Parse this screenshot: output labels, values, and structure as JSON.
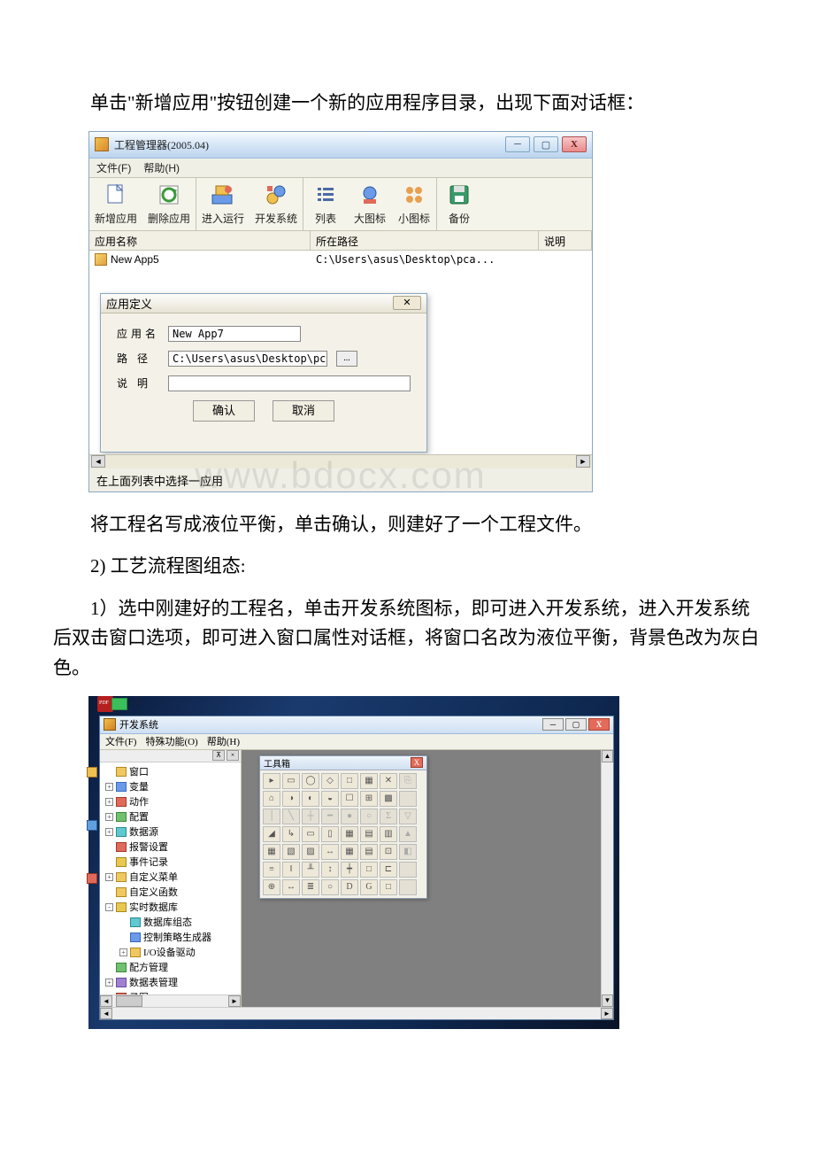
{
  "paragraphs": {
    "p1": "单击\"新增应用\"按钮创建一个新的应用程序目录，出现下面对话框：",
    "p2": "将工程名写成液位平衡，单击确认，则建好了一个工程文件。",
    "p3": "2) 工艺流程图组态:",
    "p4": "1）选中刚建好的工程名，单击开发系统图标，即可进入开发系统，进入开发系统后双击窗口选项，即可进入窗口属性对话框，将窗口名改为液位平衡，背景色改为灰白色。"
  },
  "watermark": "www.bdocx.com",
  "pm": {
    "title": "工程管理器(2005.04)",
    "menu_file": "文件(F)",
    "menu_help": "帮助(H)",
    "tb": {
      "new": "新增应用",
      "del": "删除应用",
      "run": "进入运行",
      "dev": "开发系统",
      "list": "列表",
      "big": "大图标",
      "small": "小图标",
      "backup": "备份"
    },
    "col_name": "应用名称",
    "col_path": "所在路径",
    "col_desc": "说明",
    "row_name": "New App5",
    "row_path": "C:\\Users\\asus\\Desktop\\pca...",
    "status": "在上面列表中选择一应用",
    "dlg": {
      "title": "应用定义",
      "close": "✕",
      "lbl_name": "应用名",
      "lbl_path": "路  径",
      "lbl_desc": "说  明",
      "val_name": "New App7",
      "val_path": "C:\\Users\\asus\\Desktop\\pc",
      "browse": "...",
      "ok": "确认",
      "cancel": "取消"
    }
  },
  "ds": {
    "title": "开发系统",
    "menu_file": "文件(F)",
    "menu_special": "特殊功能(O)",
    "menu_help": "帮助(H)",
    "tree": [
      {
        "level": 0,
        "exp": "",
        "icon": "folder",
        "label": "窗口"
      },
      {
        "level": 0,
        "exp": "+",
        "icon": "blue",
        "label": "变量"
      },
      {
        "level": 0,
        "exp": "+",
        "icon": "red",
        "label": "动作"
      },
      {
        "level": 0,
        "exp": "+",
        "icon": "green",
        "label": "配置"
      },
      {
        "level": 0,
        "exp": "+",
        "icon": "cyan",
        "label": "数据源"
      },
      {
        "level": 0,
        "exp": "",
        "icon": "red",
        "label": "报警设置"
      },
      {
        "level": 0,
        "exp": "",
        "icon": "yellow",
        "label": "事件记录"
      },
      {
        "level": 0,
        "exp": "+",
        "icon": "folder",
        "label": "自定义菜单"
      },
      {
        "level": 0,
        "exp": "",
        "icon": "folder",
        "label": "自定义函数"
      },
      {
        "level": 0,
        "exp": "-",
        "icon": "yellow",
        "label": "实时数据库"
      },
      {
        "level": 1,
        "exp": "",
        "icon": "cyan",
        "label": "数据库组态"
      },
      {
        "level": 1,
        "exp": "",
        "icon": "blue",
        "label": "控制策略生成器"
      },
      {
        "level": 1,
        "exp": "+",
        "icon": "folder",
        "label": "I/O设备驱动"
      },
      {
        "level": 0,
        "exp": "",
        "icon": "green",
        "label": "配方管理"
      },
      {
        "level": 0,
        "exp": "+",
        "icon": "purple",
        "label": "数据表管理"
      },
      {
        "level": 0,
        "exp": "",
        "icon": "red",
        "label": "子图"
      }
    ],
    "toolbox_title": "工具箱",
    "tree_header_pin": "⊼",
    "tree_header_close": "×"
  }
}
